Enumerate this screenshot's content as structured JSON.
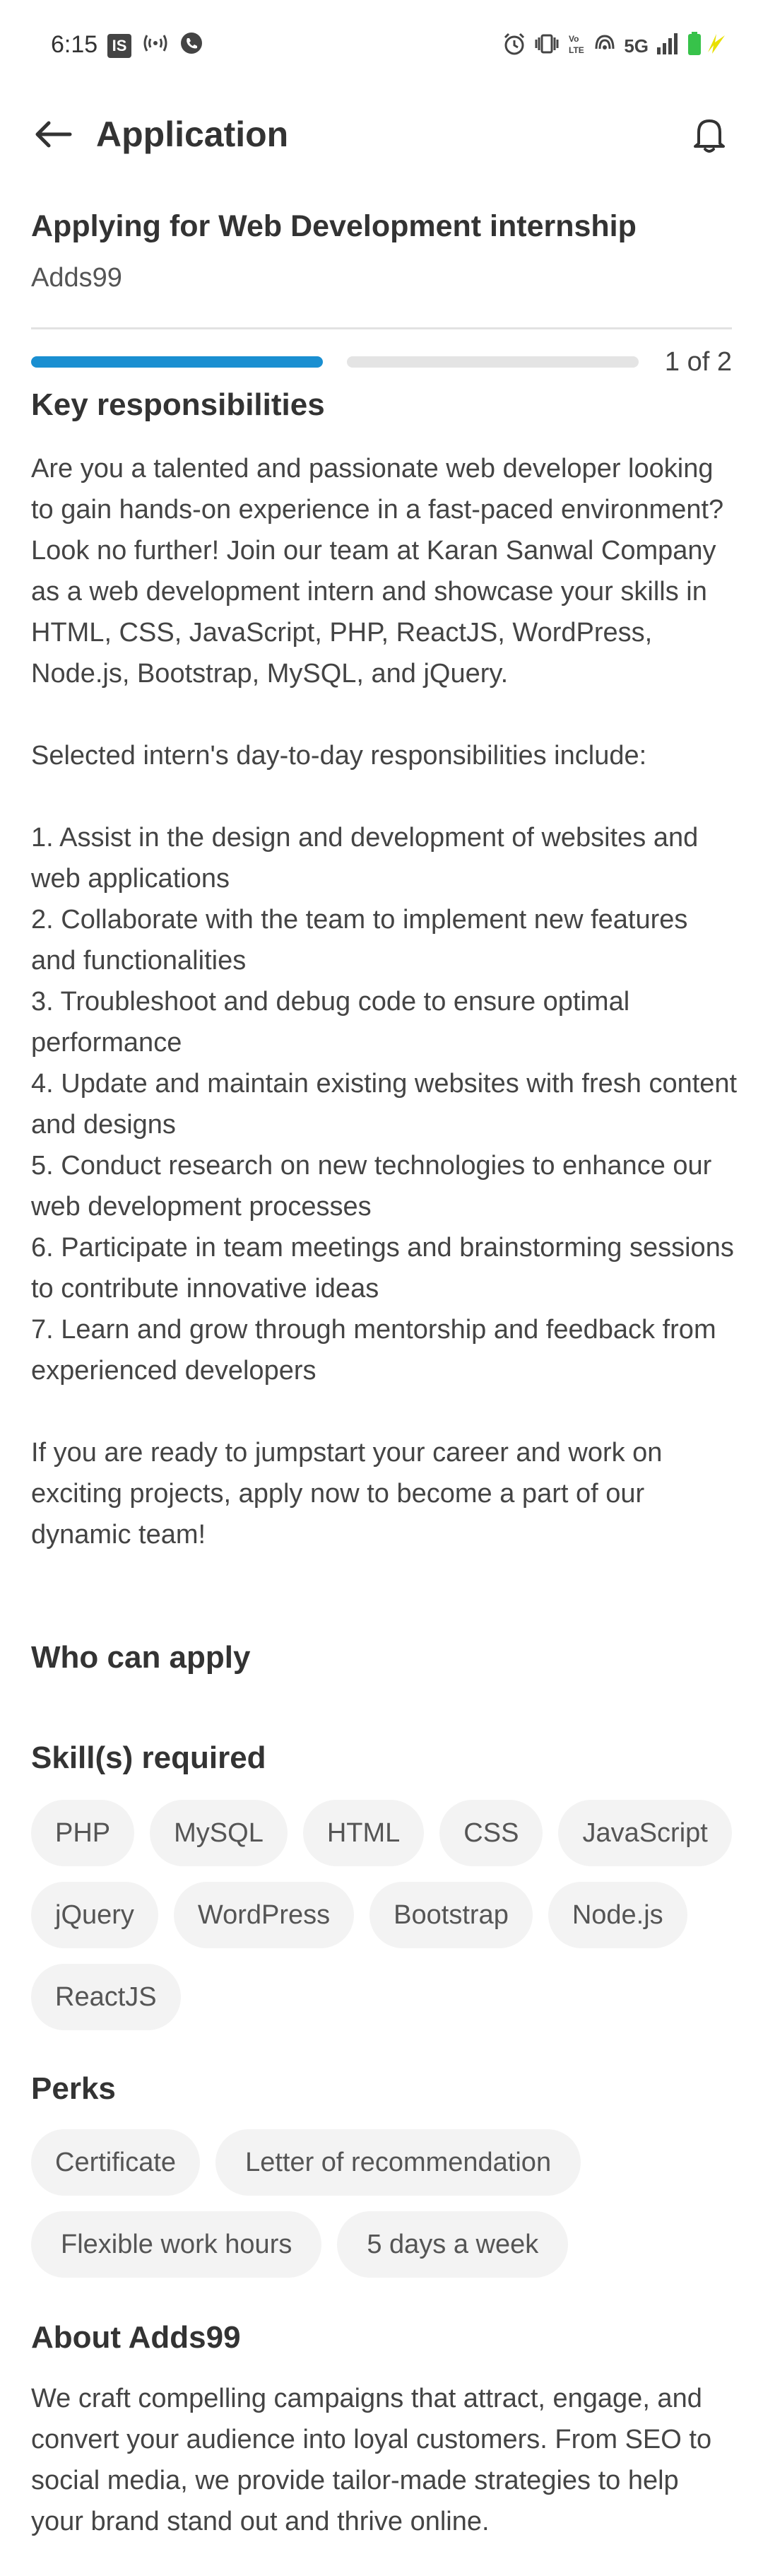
{
  "status_bar": {
    "time": "6:15",
    "left_icons": [
      "notification-badge-icon",
      "wireless-icon",
      "call-icon"
    ],
    "right_icons": [
      "alarm-icon",
      "vibrate-icon",
      "volte-icon",
      "hotspot-icon",
      "5g-icon",
      "signal-icon",
      "battery-charging-icon"
    ],
    "network_label": "5G",
    "box_letter": "IS"
  },
  "header": {
    "title": "Application",
    "back_icon": "arrow-left-icon",
    "notification_icon": "bell-icon"
  },
  "job": {
    "title": "Applying for Web Development internship",
    "company": "Adds99"
  },
  "progress": {
    "current_step": 1,
    "total_steps": 2,
    "label": "1 of 2",
    "active_color": "#1a8fd1",
    "inactive_color": "#e4e4e4"
  },
  "responsibilities": {
    "heading": "Key responsibilities",
    "intro": "Are you a talented and passionate web developer looking to gain hands-on experience in a fast-paced environment? Look no further! Join our team at Karan Sanwal Company as a web development intern and showcase your skills in HTML, CSS, JavaScript, PHP, ReactJS, WordPress, Node.js, Bootstrap, MySQL, and jQuery.",
    "list_intro": "Selected intern's day-to-day responsibilities include:",
    "items": [
      "1. Assist in the design and development of websites and web applications",
      "2. Collaborate with the team to implement new features and functionalities",
      "3. Troubleshoot and debug code to ensure optimal performance",
      "4. Update and maintain existing websites with fresh content and designs",
      "5. Conduct research on new technologies to enhance our web development processes",
      "6. Participate in team meetings and brainstorming sessions to contribute innovative ideas",
      "7. Learn and grow through mentorship and feedback from experienced developers"
    ],
    "outro": "If you are ready to jumpstart your career and work on exciting projects, apply now to become a part of our dynamic team!"
  },
  "who_can_apply": {
    "heading": "Who can apply"
  },
  "skills": {
    "heading": "Skill(s) required",
    "items": [
      "PHP",
      "MySQL",
      "HTML",
      "CSS",
      "JavaScript",
      "jQuery",
      "WordPress",
      "Bootstrap",
      "Node.js",
      "ReactJS"
    ]
  },
  "perks": {
    "heading": "Perks",
    "items": [
      "Certificate",
      "Letter of recommendation",
      "Flexible work hours",
      "5 days a week"
    ]
  },
  "about": {
    "heading": "About Adds99",
    "text": "We craft compelling campaigns that attract, engage, and convert your audience into loyal customers. From SEO to social media, we provide tailor-made strategies to help your brand stand out and thrive online."
  }
}
